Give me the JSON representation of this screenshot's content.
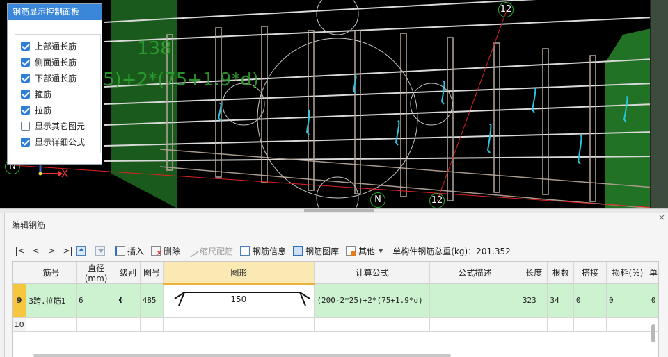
{
  "viewport": {
    "axis_top": "12",
    "axis_bottom_right": "12",
    "axis_bottom_mid": "N",
    "axis_left": "N",
    "axis_x_label": "X",
    "overlay_text_1": "138",
    "overlay_text_2": "5)+2*(75+1.9*d)"
  },
  "control_panel": {
    "title": "钢筋显示控制面板",
    "options": [
      {
        "label": "上部通长筋",
        "checked": true
      },
      {
        "label": "侧面通长筋",
        "checked": true
      },
      {
        "label": "下部通长筋",
        "checked": true
      },
      {
        "label": "箍筋",
        "checked": true
      },
      {
        "label": "拉筋",
        "checked": true
      },
      {
        "label": "显示其它图元",
        "checked": false
      },
      {
        "label": "显示详细公式",
        "checked": true
      }
    ]
  },
  "edit_panel": {
    "title": "编辑钢筋",
    "close": "×",
    "toolbar": {
      "first": "|<",
      "prev": "<",
      "next": ">",
      "last": ">|",
      "insert": "插入",
      "delete": "删除",
      "ruler": "缩尺配筋",
      "rebar_info": "钢筋信息",
      "rebar_library": "钢筋图库",
      "other": "其他",
      "total_weight": "单构件钢筋总重(kg)：201.352"
    },
    "columns": [
      "筋号",
      "直径(mm)",
      "级别",
      "图号",
      "图形",
      "计算公式",
      "公式描述",
      "长度",
      "根数",
      "搭接",
      "损耗(%)",
      "单"
    ],
    "rows": [
      {
        "num": "9",
        "bar_no": "3跨.拉筋1",
        "diameter": "6",
        "grade": "Φ",
        "fig_no": "485",
        "shape_value": "150",
        "formula": "(200-2*25)+2*(75+1.9*d)",
        "formula_desc": "",
        "length": "323",
        "count": "34",
        "lap": "0",
        "loss": "0",
        "extra": "0"
      }
    ],
    "empty_row_num": "10"
  }
}
